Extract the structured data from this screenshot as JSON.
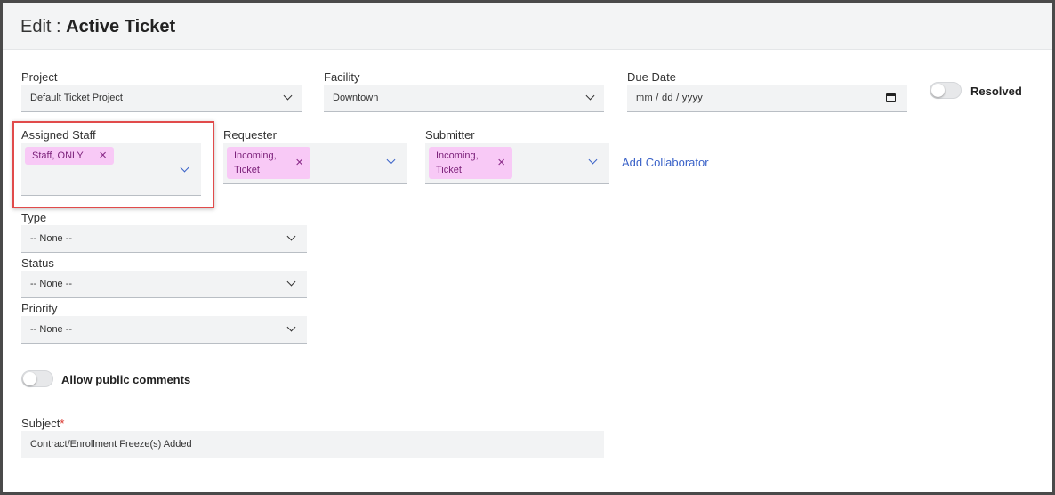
{
  "header": {
    "prefix": "Edit :",
    "title": "Active Ticket"
  },
  "fields": {
    "project": {
      "label": "Project",
      "value": "Default Ticket Project"
    },
    "facility": {
      "label": "Facility",
      "value": "Downtown"
    },
    "due_date": {
      "label": "Due Date",
      "placeholder": "mm / dd / yyyy"
    },
    "resolved": {
      "label": "Resolved",
      "on": false
    },
    "assigned_staff": {
      "label": "Assigned Staff",
      "chips": [
        "Staff, ONLY"
      ]
    },
    "requester": {
      "label": "Requester",
      "chips": [
        [
          "Incoming,",
          "Ticket"
        ]
      ]
    },
    "submitter": {
      "label": "Submitter",
      "chips": [
        [
          "Incoming,",
          "Ticket"
        ]
      ]
    },
    "add_collaborator": "Add Collaborator",
    "type": {
      "label": "Type",
      "value": "-- None --"
    },
    "status": {
      "label": "Status",
      "value": "-- None --"
    },
    "priority": {
      "label": "Priority",
      "value": "-- None --"
    },
    "public_comments": {
      "label": "Allow public comments",
      "on": false
    },
    "subject": {
      "label": "Subject",
      "required_mark": "*",
      "value": "Contract/Enrollment Freeze(s) Added"
    }
  },
  "colors": {
    "chip_bg": "#f8c9f6",
    "chip_text": "#7a1f78",
    "link": "#3a62c8",
    "highlight": "#e14b4b"
  },
  "chip_remove_glyph": "×"
}
